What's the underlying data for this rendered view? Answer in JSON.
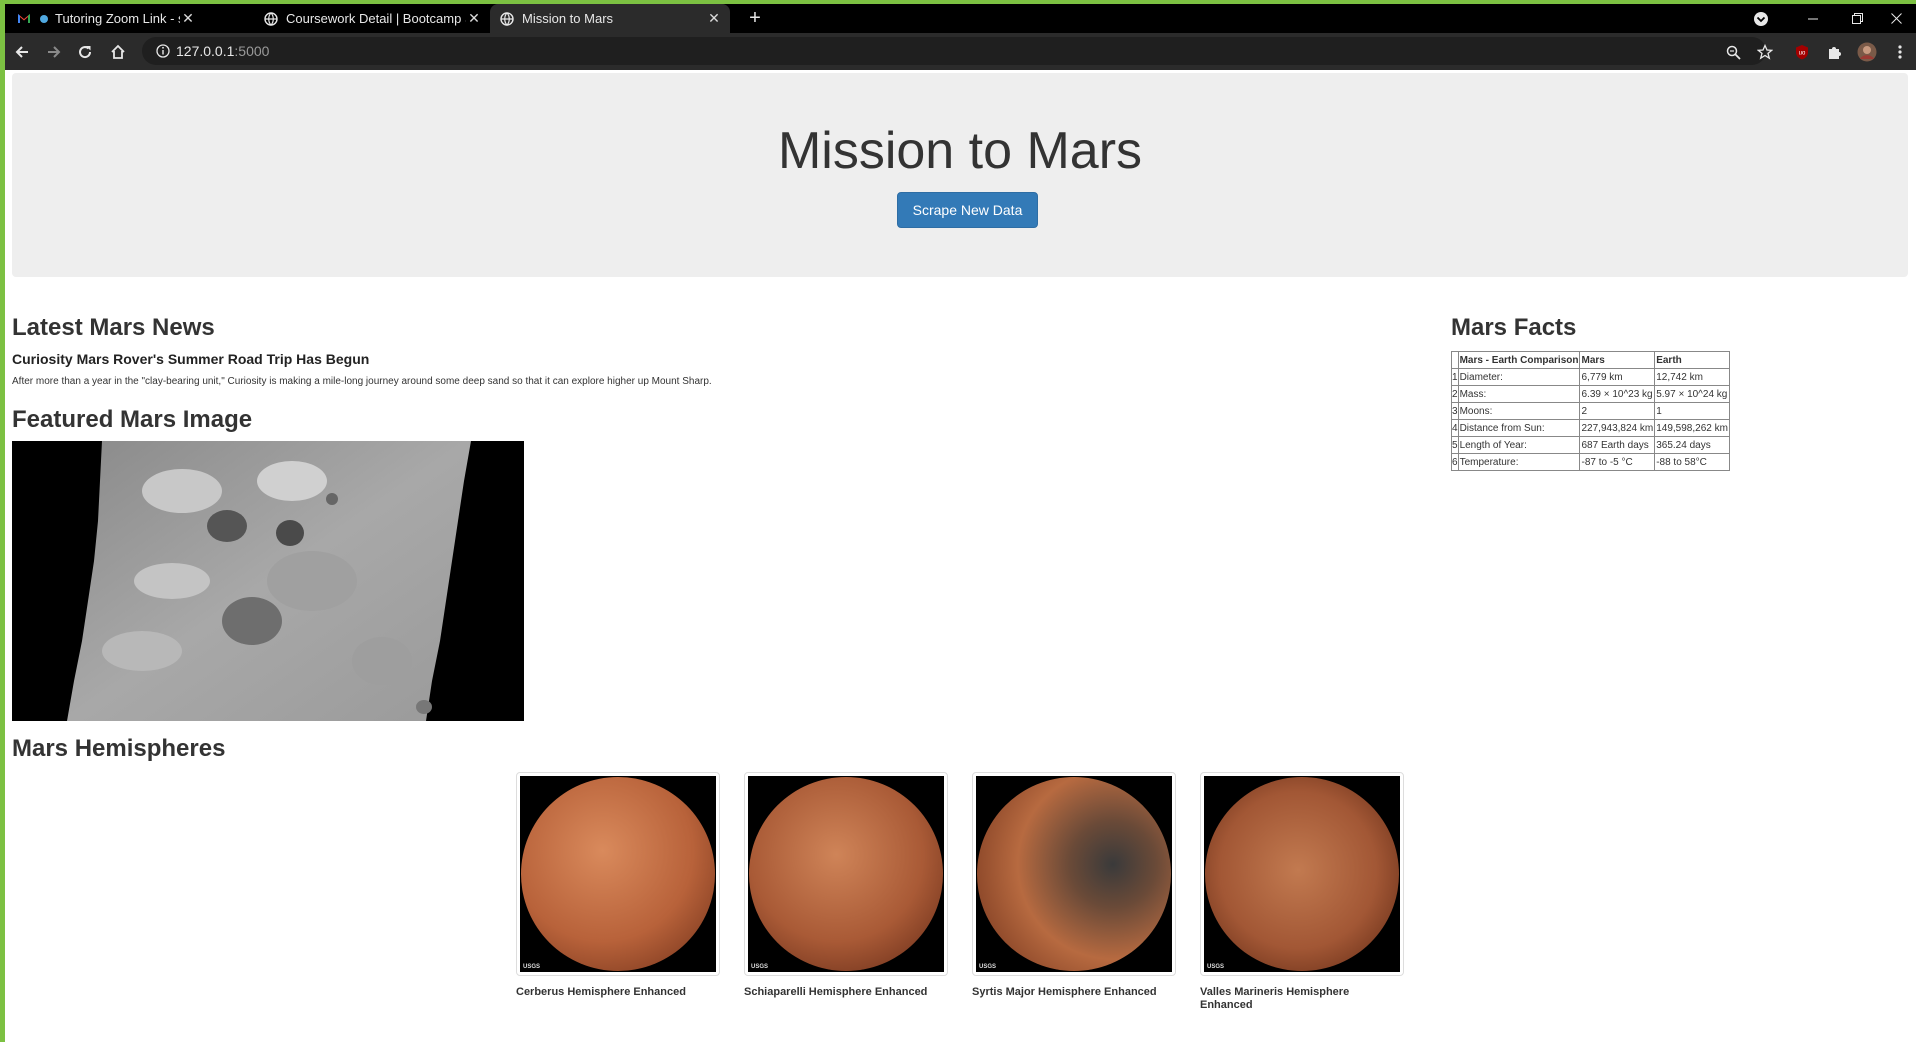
{
  "browser": {
    "tabs": [
      {
        "title": "Tutoring Zoom Link - stevenh",
        "icon": "gmail-icon"
      },
      {
        "title": "Coursework Detail | Bootcamp Sp",
        "icon": "globe-icon"
      },
      {
        "title": "Mission to Mars",
        "icon": "globe-icon",
        "active": true
      }
    ],
    "url_host": "127.0.0.1",
    "url_port": ":5000",
    "new_tab_label": "+"
  },
  "jumbotron": {
    "title": "Mission to Mars",
    "button_label": "Scrape New Data"
  },
  "news": {
    "heading": "Latest Mars News",
    "title": "Curiosity Mars Rover's Summer Road Trip Has Begun",
    "paragraph": "After more than a year in the \"clay-bearing unit,\" Curiosity is making a mile-long journey around some deep sand so that it can explore higher up Mount Sharp."
  },
  "featured": {
    "heading": "Featured Mars Image"
  },
  "facts": {
    "heading": "Mars Facts",
    "columns": [
      "Mars - Earth Comparison",
      "Mars",
      "Earth"
    ],
    "rows": [
      {
        "idx": "1",
        "label": "Diameter:",
        "mars": "6,779 km",
        "earth": "12,742 km"
      },
      {
        "idx": "2",
        "label": "Mass:",
        "mars": "6.39 × 10^23 kg",
        "earth": "5.97 × 10^24 kg"
      },
      {
        "idx": "3",
        "label": "Moons:",
        "mars": "2",
        "earth": "1"
      },
      {
        "idx": "4",
        "label": "Distance from Sun:",
        "mars": "227,943,824 km",
        "earth": "149,598,262 km"
      },
      {
        "idx": "5",
        "label": "Length of Year:",
        "mars": "687 Earth days",
        "earth": "365.24 days"
      },
      {
        "idx": "6",
        "label": "Temperature:",
        "mars": "-87 to -5 °C",
        "earth": "-88 to 58°C"
      }
    ]
  },
  "hemispheres": {
    "heading": "Mars Hemispheres",
    "items": [
      {
        "title": "Cerberus Hemisphere Enhanced",
        "color": "#b8623a"
      },
      {
        "title": "Schiaparelli Hemisphere Enhanced",
        "color": "#a95a36"
      },
      {
        "title": "Syrtis Major Hemisphere Enhanced",
        "color": "#b76a40"
      },
      {
        "title": "Valles Marineris Hemisphere Enhanced",
        "color": "#a25735"
      }
    ],
    "watermark": "USGS"
  }
}
